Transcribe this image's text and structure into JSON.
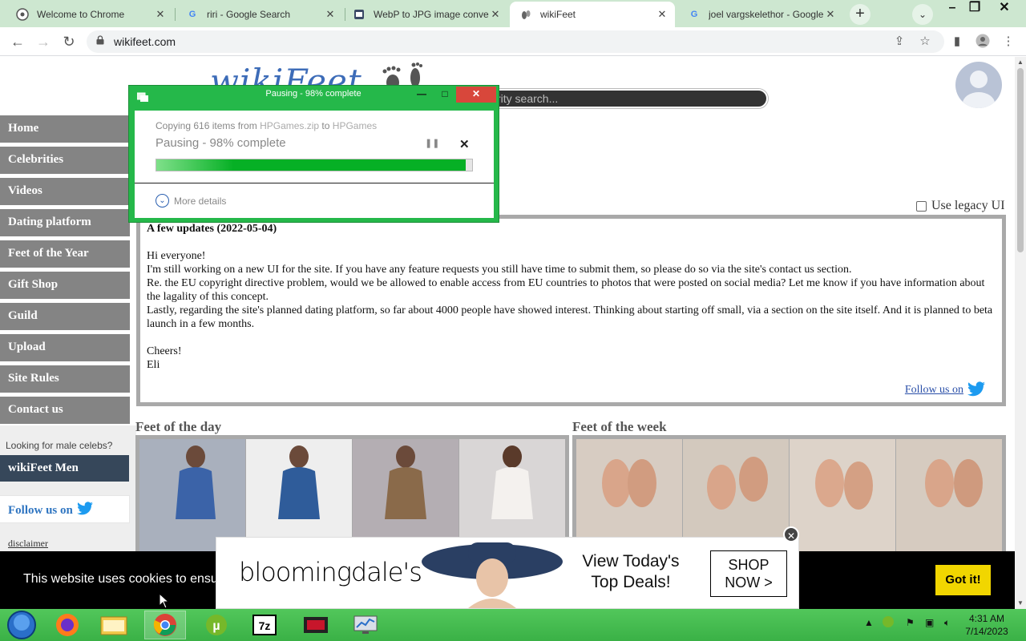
{
  "browser": {
    "tabs": [
      {
        "title": "Welcome to Chrome",
        "icon": "chrome-icon"
      },
      {
        "title": "riri - Google Search",
        "icon": "google-icon"
      },
      {
        "title": "WebP to JPG image conver",
        "icon": "image-converter-icon"
      },
      {
        "title": "wikiFeet",
        "icon": "wikifeet-icon"
      },
      {
        "title": "joel vargskelethor - Google",
        "icon": "google-icon"
      }
    ],
    "url": "wikifeet.com"
  },
  "site": {
    "logo": "wikiFeet",
    "search_placeholder": "rity search...",
    "nav": [
      "Home",
      "Celebrities",
      "Videos",
      "Dating platform",
      "Feet of the Year",
      "Gift Shop",
      "Guild",
      "Upload",
      "Site Rules",
      "Contact us"
    ],
    "male_prompt": "Looking for male celebs?",
    "men_button": "wikiFeet Men",
    "follow_side": "Follow us on",
    "disclaimer": "disclaimer",
    "legacy_label": "Use legacy UI",
    "news": {
      "title": "A few updates (2022-05-04)",
      "greeting": "Hi everyone!",
      "p1": "I'm still working on a new UI for the site. If you have any feature requests you still have time to submit them, so please do so via the site's contact us section.",
      "p2": "Re. the EU copyright directive problem, would we be allowed to enable access from EU countries to photos that were posted on social media? Let me know if you have information about the lagality of this concept.",
      "p3": "Lastly, regarding the site's planned dating platform, so far about 4000 people have showed interest. Thinking about starting off small, via a section on the site itself. And it is planned to beta launch in a few months.",
      "signoff": "Cheers!",
      "name": "Eli",
      "follow": "Follow us on"
    },
    "feet_day_title": "Feet of the day",
    "feet_week_title": "Feet of the week"
  },
  "dialog": {
    "title": "Pausing - 98% complete",
    "copy_prefix": "Copying 616 items from ",
    "copy_from": "HPGames.zip",
    "copy_mid": " to ",
    "copy_to": "HPGames",
    "status": "Pausing - 98% complete",
    "progress": 0.98,
    "more_details": "More details"
  },
  "cookie": {
    "text": "This website uses cookies to ensu",
    "button": "Got it!"
  },
  "ad": {
    "brand": "bloomingdale's",
    "tagline": "View Today's Top Deals!",
    "cta": "SHOP NOW >"
  },
  "taskbar": {
    "time": "4:31 AM",
    "date": "7/14/2023"
  },
  "colors": {
    "taskbar": "#3ab146",
    "dialog": "#25b84a",
    "nav": "#848484",
    "cookie_button": "#f1d600"
  }
}
